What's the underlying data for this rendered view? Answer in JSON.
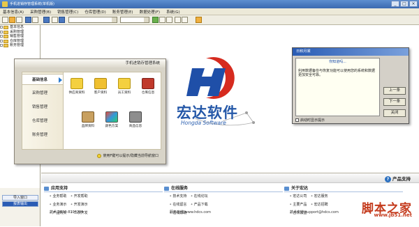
{
  "window": {
    "title": "手机进销存管理系统(单机版)",
    "controls": [
      "_",
      "□",
      "×"
    ]
  },
  "menu": [
    "基本信息(A)",
    "采购管理(B)",
    "销售管理(C)",
    "仓库管理(D)",
    "账务管理(E)",
    "数据处理(F)",
    "系统(G)"
  ],
  "tree": {
    "items": [
      "基本信息",
      "采购管理",
      "销售管理",
      "仓库管理",
      "账务管理"
    ]
  },
  "module": {
    "title": "手机进销存管理系统",
    "nav": [
      "基础信息",
      "采购管理",
      "销售管理",
      "仓库管理",
      "账务管理"
    ],
    "icons": [
      "供应商资料",
      "客户资料",
      "员工资料",
      "仓库信息",
      "品牌资料",
      "颜色方案",
      "商品信息"
    ],
    "footer": "使用F键可以提示/隐藏当前导航窗口"
  },
  "brand": {
    "cn": "宏达软件",
    "en": "Hongda Software"
  },
  "dialog": {
    "title": "日积月累",
    "heading": "你知道吗...",
    "body": "利用数据备份与恢复功能可以使用您的系统和数据更加安全可靠。",
    "buttons": [
      "上一条",
      "下一条",
      "关闭"
    ],
    "checkbox": "启动时显示提示"
  },
  "support": {
    "label": "产品支持"
  },
  "columns": [
    {
      "title": "应用支持",
      "rows": [
        [
          "业务帮助",
          "开发帮助"
        ],
        [
          "业务演示",
          "开发演示"
        ],
        [
          "产品购买",
          "二次开发"
        ]
      ],
      "contact": "技术:0630-8396295"
    },
    {
      "title": "在线服务",
      "rows": [
        [
          "技术支持",
          "在线论坛"
        ],
        [
          "在线留言",
          "产品下载"
        ],
        [
          "在线帮助"
        ]
      ],
      "contact": "服务在线:www.hdcs.com"
    },
    {
      "title": "关于宏达",
      "rows": [
        [
          "宏达公司",
          "宏达服务"
        ],
        [
          "主要产品",
          "宏达招聘"
        ],
        [
          "合作加盟"
        ]
      ],
      "contact": "技术支持:support@hdcs.com"
    }
  ],
  "leftpanel": {
    "buttons": [
      "导入窗口",
      "报表输出"
    ]
  },
  "watermark": {
    "cn": "脚本之家",
    "url": "www.jb51.net"
  }
}
